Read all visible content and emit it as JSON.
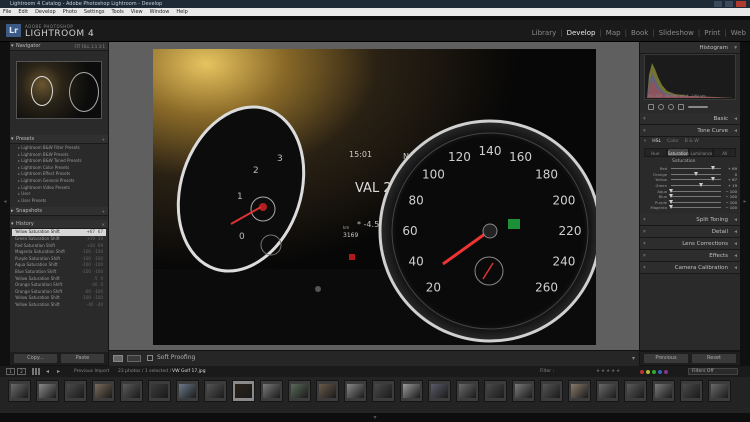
{
  "window": {
    "title": "Lightroom 4 Catalog - Adobe Photoshop Lightroom - Develop"
  },
  "menu": [
    "File",
    "Edit",
    "Develop",
    "Photo",
    "Settings",
    "Tools",
    "View",
    "Window",
    "Help"
  ],
  "brand": {
    "small": "ADOBE PHOTOSHOP",
    "big": "LIGHTROOM 4",
    "logo": "Lr"
  },
  "modules": [
    "Library",
    "Develop",
    "Map",
    "Book",
    "Slideshow",
    "Print",
    "Web"
  ],
  "active_module": "Develop",
  "left": {
    "navigator": {
      "title": "Navigator",
      "opts": "FIT  FILL  1:1  3:1"
    },
    "presets": {
      "title": "Presets",
      "items": [
        "Lightroom B&W Filter Presets",
        "Lightroom B&W Presets",
        "Lightroom B&W Toned Presets",
        "Lightroom Color Presets",
        "Lightroom Effect Presets",
        "Lightroom General Presets",
        "Lightroom Video Presets",
        "User",
        "User Presets"
      ]
    },
    "snapshots": {
      "title": "Snapshots"
    },
    "history": {
      "title": "History",
      "rows": [
        {
          "label": "Yellow Saturation Shift",
          "a": "+67",
          "b": "67"
        },
        {
          "label": "Green Saturation Shift",
          "a": "+19",
          "b": "19"
        },
        {
          "label": "Red Saturation Shift",
          "a": "+20",
          "b": "69"
        },
        {
          "label": "Magenta Saturation Shift",
          "a": "-100",
          "b": "-100"
        },
        {
          "label": "Purple Saturation Shift",
          "a": "-100",
          "b": "-100"
        },
        {
          "label": "Aqua Saturation Shift",
          "a": "-100",
          "b": "-100"
        },
        {
          "label": "Blue Saturation Shift",
          "a": "-100",
          "b": "-100"
        },
        {
          "label": "Yellow Saturation Shift",
          "a": "-5",
          "b": "0"
        },
        {
          "label": "Orange Saturation Shift",
          "a": "-40",
          "b": "0"
        },
        {
          "label": "Orange Saturation Shift",
          "a": "-60",
          "b": "-100"
        },
        {
          "label": "Yellow Saturation Shift",
          "a": "-100",
          "b": "-100"
        },
        {
          "label": "Yellow Saturation Shift",
          "a": "-40",
          "b": "-40"
        }
      ]
    },
    "buttons": {
      "copy": "Copy...",
      "paste": "Paste"
    }
  },
  "toolbar": {
    "soft_proofing": "Soft Proofing"
  },
  "right": {
    "histogram": {
      "title": "Histogram",
      "readout": [
        "ISO 200",
        "18 mm",
        "f/5.6",
        "1/60 sec"
      ]
    },
    "panels": [
      "Basic",
      "Tone Curve"
    ],
    "hsl": {
      "header": [
        "HSL",
        "Color",
        "B & W"
      ],
      "tabs": [
        "Hue",
        "Saturation",
        "Luminance",
        "All"
      ],
      "active_tab": "Saturation",
      "section": "Saturation"
    },
    "saturation": [
      {
        "label": "Red",
        "value": "+ 69",
        "pct": 0.845
      },
      {
        "label": "Orange",
        "value": "0",
        "pct": 0.5
      },
      {
        "label": "Yellow",
        "value": "+ 67",
        "pct": 0.835
      },
      {
        "label": "Green",
        "value": "+ 19",
        "pct": 0.595
      },
      {
        "label": "Aqua",
        "value": "− 100",
        "pct": 0
      },
      {
        "label": "Blue",
        "value": "− 100",
        "pct": 0
      },
      {
        "label": "Purple",
        "value": "− 100",
        "pct": 0
      },
      {
        "label": "Magenta",
        "value": "− 100",
        "pct": 0
      }
    ],
    "lower_panels": [
      "Split Toning",
      "Detail",
      "Lens Corrections",
      "Effects",
      "Camera Calibration"
    ],
    "buttons": {
      "previous": "Previous",
      "reset": "Reset"
    }
  },
  "filmstrip": {
    "screens": [
      "1",
      "2"
    ],
    "source": "Previous Import",
    "count": "23 photos / 1 selected /",
    "filename": "VW Golf 17.jpg",
    "filter_label": "Filter :",
    "filters_off": "Filters Off",
    "thumb_count": 26,
    "selected_index": 8
  },
  "photo": {
    "clock": "15:01",
    "gear": "N",
    "reg": "VAL 202",
    "temp": "* -4.5",
    "odo_label": "km",
    "odo_value": "3169",
    "left_gauge_ticks": [
      "0",
      "1",
      "2",
      "3"
    ],
    "speed_ticks": [
      "20",
      "40",
      "60",
      "80",
      "100",
      "120",
      "140",
      "160",
      "180",
      "200",
      "220",
      "240",
      "260"
    ]
  },
  "colors": {
    "accent": "#c8c8c8",
    "selected_row": "#d8d8d8",
    "panel": "#2a2a2a"
  }
}
